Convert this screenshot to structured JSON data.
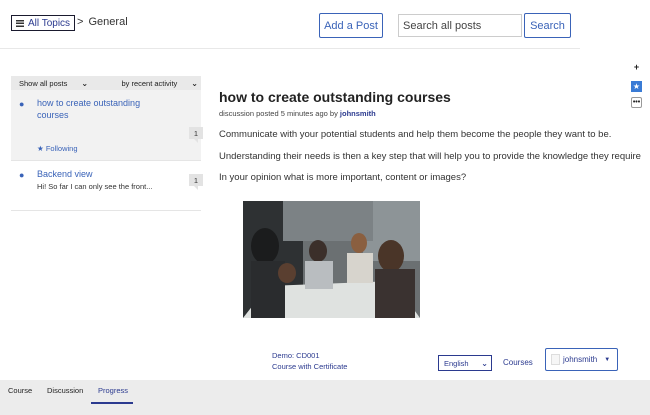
{
  "header": {
    "all_topics_label": "All Topics",
    "breadcrumb_separator": ">",
    "current_topic": "General",
    "add_post_label": "Add a Post",
    "search_placeholder": "Search all posts",
    "search_button_label": "Search"
  },
  "tools": {
    "expand_icon": "plus-icon",
    "bookmark_icon": "star-icon",
    "more_icon": "more-icon"
  },
  "sidebar": {
    "filter_label": "Show all posts",
    "sort_label": "by recent activity",
    "threads": [
      {
        "title": "how to create outstanding courses",
        "status": "Following",
        "count": "1",
        "active": true
      },
      {
        "title": "Backend view",
        "excerpt": "Hi! So far I can only see the front...",
        "count": "1",
        "active": false
      }
    ]
  },
  "post": {
    "title": "how to create outstanding courses",
    "meta_prefix": "discussion posted 5 minutes ago by",
    "author": "johnsmith",
    "paragraphs": [
      "Communicate with your potential students and help them become the people they want to be.",
      "Understanding their needs is then a key step that will help you to provide the knowledge they require",
      "In your opinion what is more important, content or images?"
    ],
    "image_icon": "photo-group-meeting"
  },
  "footer": {
    "course_code": "Demo: CD001",
    "course_name": "Course with Certificate",
    "language": "English",
    "courses_label": "Courses",
    "username": "johnsmith"
  },
  "bottom_tabs": [
    {
      "label": "Course",
      "active": false
    },
    {
      "label": "Discussion",
      "active": false
    },
    {
      "label": "Progress",
      "active": true
    }
  ],
  "colors": {
    "accent": "#3a63b8",
    "link_dark": "#2b3a8f",
    "bar_bg": "#ececec",
    "bookmark_bg": "#3a7bd5"
  }
}
